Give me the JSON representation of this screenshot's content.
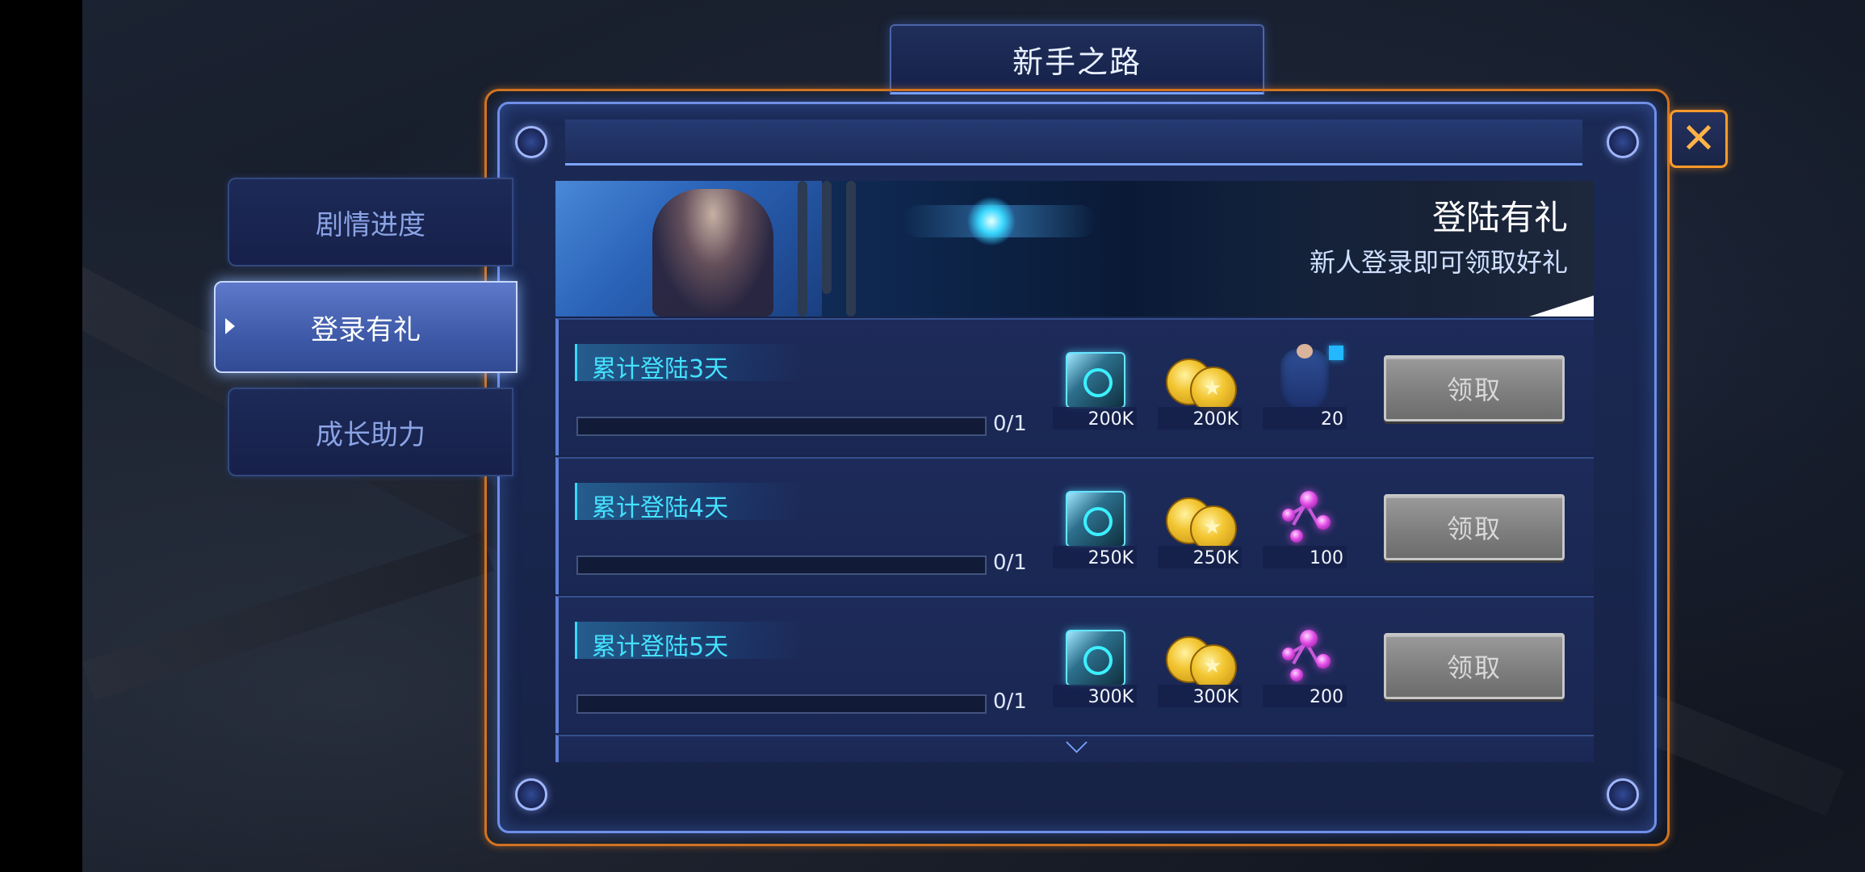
{
  "header": {
    "title": "新手之路"
  },
  "sidebar": {
    "tabs": [
      {
        "label": "剧情进度",
        "active": false
      },
      {
        "label": "登录有礼",
        "active": true
      },
      {
        "label": "成长助力",
        "active": false
      }
    ]
  },
  "banner": {
    "title": "登陆有礼",
    "subtitle": "新人登录即可领取好礼"
  },
  "rewards": [
    {
      "label": "累计登陆3天",
      "progress_text": "0/1",
      "progress_fraction": 0,
      "items": [
        {
          "icon": "crate-icon",
          "qty": "200K"
        },
        {
          "icon": "gold-coin-icon",
          "qty": "200K"
        },
        {
          "icon": "swimsuit-icon",
          "qty": "20"
        }
      ],
      "button": "领取"
    },
    {
      "label": "累计登陆4天",
      "progress_text": "0/1",
      "progress_fraction": 0,
      "items": [
        {
          "icon": "crate-icon",
          "qty": "250K"
        },
        {
          "icon": "gold-coin-icon",
          "qty": "250K"
        },
        {
          "icon": "molecule-icon",
          "qty": "100"
        }
      ],
      "button": "领取"
    },
    {
      "label": "累计登陆5天",
      "progress_text": "0/1",
      "progress_fraction": 0,
      "items": [
        {
          "icon": "crate-icon",
          "qty": "300K"
        },
        {
          "icon": "gold-coin-icon",
          "qty": "300K"
        },
        {
          "icon": "molecule-icon",
          "qty": "200"
        }
      ],
      "button": "领取"
    }
  ],
  "colors": {
    "accent_orange": "#d3731f",
    "frame_blue": "#6f8fe8",
    "label_cyan": "#44e2ff",
    "button_gray": "#7f7f7f"
  },
  "close_icon": "close-icon"
}
